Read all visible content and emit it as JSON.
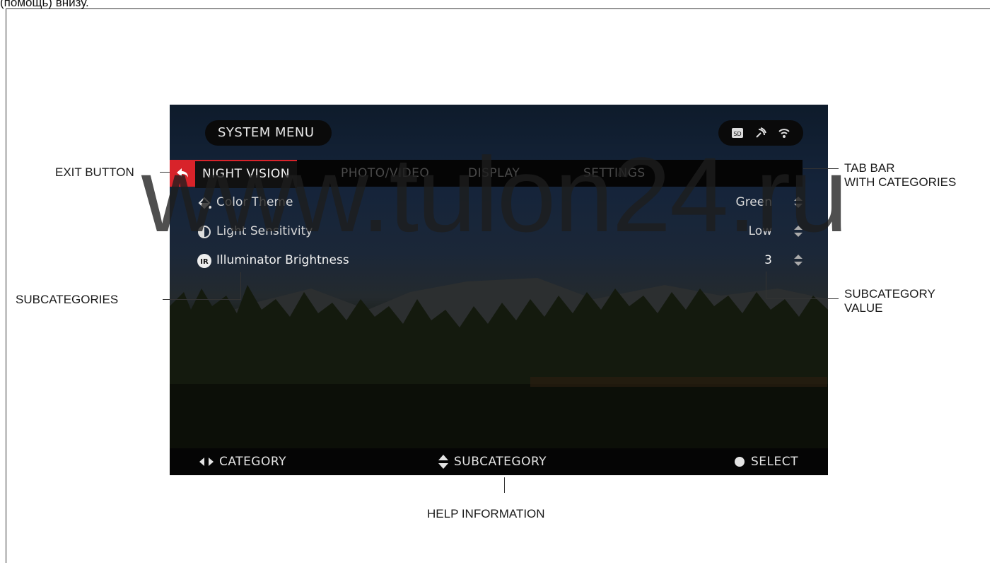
{
  "caption": "(помощь) внизу.",
  "watermark": "www.tulon24.ru",
  "screen": {
    "title": "SYSTEM MENU",
    "status_icons": [
      "sd-card-icon",
      "satellite-icon",
      "wifi-icon"
    ],
    "tabs": [
      {
        "label": "NIGHT VISION",
        "active": true
      },
      {
        "label": "PHOTO/VIDEO",
        "active": false
      },
      {
        "label": "DISPLAY",
        "active": false
      },
      {
        "label": "SETTINGS",
        "active": false
      }
    ],
    "rows": [
      {
        "icon": "paint-bucket-icon",
        "label": "Color Theme",
        "value": "Green"
      },
      {
        "icon": "contrast-icon",
        "label": "Light Sensitivity",
        "value": "Low"
      },
      {
        "icon": "ir-icon",
        "label": "Illuminator Brightness",
        "value": "3",
        "icon_text": "IR"
      }
    ],
    "help": {
      "category": "CATEGORY",
      "subcategory": "SUBCATEGORY",
      "select": "SELECT"
    }
  },
  "callouts": {
    "exit_button": "EXIT BUTTON",
    "tab_bar_line1": "TAB BAR",
    "tab_bar_line2": "WITH CATEGORIES",
    "subcategories": "SUBCATEGORIES",
    "subcategory_value_line1": "SUBCATEGORY",
    "subcategory_value_line2": "VALUE",
    "help_information": "HELP INFORMATION"
  },
  "colors": {
    "accent_red": "#d8232a",
    "bar_black": "#050505"
  }
}
